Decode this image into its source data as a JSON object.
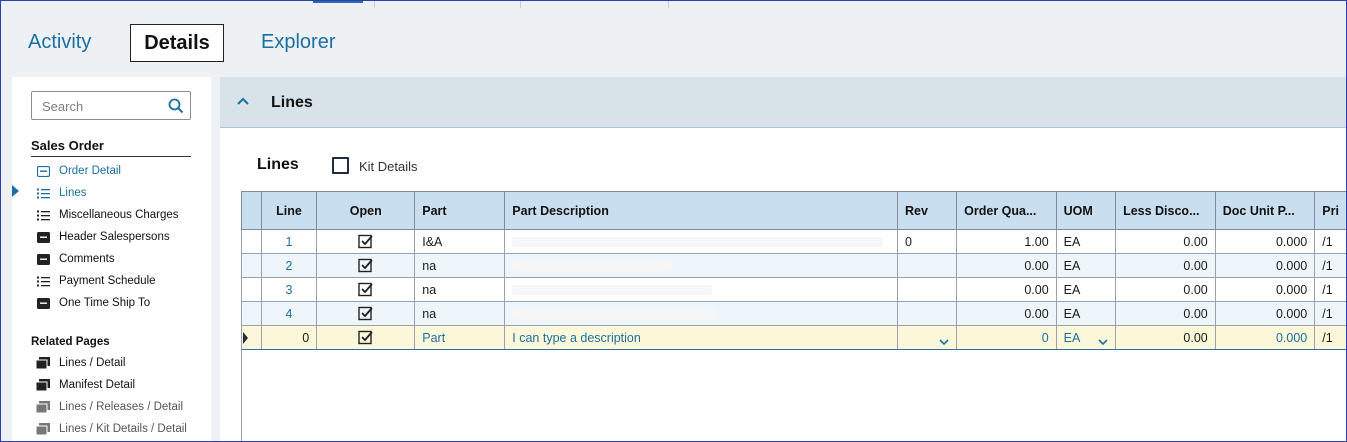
{
  "tabs": [
    {
      "label": "Activity"
    },
    {
      "label": "Details"
    },
    {
      "label": "Explorer"
    }
  ],
  "sidebar": {
    "search_placeholder": "Search",
    "section_title": "Sales Order",
    "items": [
      {
        "label": "Order Detail",
        "icon": "form-icon"
      },
      {
        "label": "Lines",
        "icon": "list-icon"
      },
      {
        "label": "Miscellaneous Charges",
        "icon": "list-icon"
      },
      {
        "label": "Header Salespersons",
        "icon": "form-icon"
      },
      {
        "label": "Comments",
        "icon": "form-icon"
      },
      {
        "label": "Payment Schedule",
        "icon": "list-icon"
      },
      {
        "label": "One Time Ship To",
        "icon": "form-icon"
      }
    ],
    "related_title": "Related Pages",
    "related": [
      {
        "label": "Lines / Detail"
      },
      {
        "label": "Manifest Detail"
      },
      {
        "label": "Lines / Releases / Detail"
      },
      {
        "label": "Lines / Kit Details / Detail"
      }
    ]
  },
  "main": {
    "band_title": "Lines",
    "grid_title": "Lines",
    "kit_details_label": "Kit Details",
    "columns": [
      "Line",
      "Open",
      "Part",
      "Part Description",
      "Rev",
      "Order Qua...",
      "UOM",
      "Less Disco...",
      "Doc Unit P...",
      "Pri"
    ],
    "rows": [
      {
        "line": "1",
        "open": true,
        "part": "I&A",
        "rev": "0",
        "order_qty": "1.00",
        "uom": "EA",
        "less_disc": "0.00",
        "doc_unit_price": "0.000",
        "pri": "/1"
      },
      {
        "line": "2",
        "open": true,
        "part": "na",
        "rev": "",
        "order_qty": "0.00",
        "uom": "EA",
        "less_disc": "0.00",
        "doc_unit_price": "0.000",
        "pri": "/1"
      },
      {
        "line": "3",
        "open": true,
        "part": "na",
        "rev": "",
        "order_qty": "0.00",
        "uom": "EA",
        "less_disc": "0.00",
        "doc_unit_price": "0.000",
        "pri": "/1"
      },
      {
        "line": "4",
        "open": true,
        "part": "na",
        "rev": "",
        "order_qty": "0.00",
        "uom": "EA",
        "less_disc": "0.00",
        "doc_unit_price": "0.000",
        "pri": "/1"
      }
    ],
    "edit_row": {
      "line": "0",
      "open": true,
      "part": "Part",
      "description": "I can type a description",
      "order_qty": "0",
      "uom": "EA",
      "less_disc": "0.00",
      "doc_unit_price": "0.000",
      "pri": "/1"
    }
  }
}
